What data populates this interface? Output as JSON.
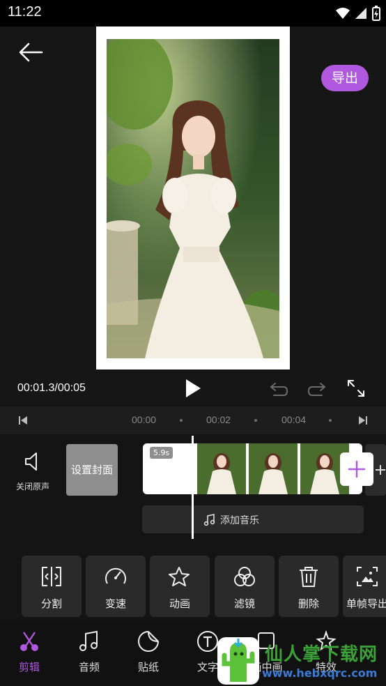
{
  "status_bar": {
    "time": "11:22"
  },
  "header": {
    "export_label": "导出"
  },
  "player": {
    "timecode": "00:01.3/00:05"
  },
  "ruler": {
    "marks": [
      "00:00",
      "00:02",
      "00:04"
    ]
  },
  "timeline": {
    "mute_label": "关闭原声",
    "cover_label": "设置封面",
    "clip_duration": "5.9s",
    "add_music_label": "添加音乐"
  },
  "tools": [
    {
      "label": "分割",
      "icon": "split-icon"
    },
    {
      "label": "变速",
      "icon": "speed-icon"
    },
    {
      "label": "动画",
      "icon": "animation-star-icon"
    },
    {
      "label": "滤镜",
      "icon": "filter-icon"
    },
    {
      "label": "删除",
      "icon": "trash-icon"
    },
    {
      "label": "单帧导出",
      "icon": "frame-export-icon"
    }
  ],
  "bottom_nav": [
    {
      "label": "剪辑",
      "icon": "scissors-icon",
      "active": true
    },
    {
      "label": "音频",
      "icon": "music-note-icon"
    },
    {
      "label": "贴纸",
      "icon": "sticker-icon"
    },
    {
      "label": "文字",
      "icon": "text-icon"
    },
    {
      "label": "画中画",
      "icon": "pip-icon"
    },
    {
      "label": "特效",
      "icon": "effects-icon"
    }
  ],
  "watermark": {
    "text": "仙人掌下载网",
    "url": "www.hebxqrc.com"
  },
  "colors": {
    "accent": "#b158e0",
    "background": "#141414",
    "panel": "#2a2a2a"
  }
}
